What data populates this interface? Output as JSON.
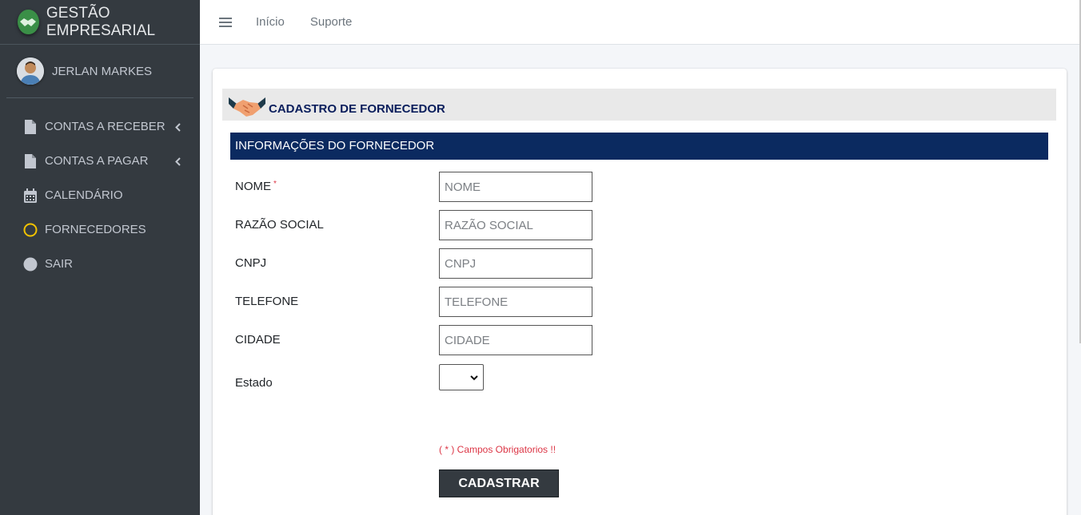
{
  "brand": {
    "title": "GESTÃO EMPRESARIAL"
  },
  "user": {
    "name": "JERLAN MARKES"
  },
  "sidebar": {
    "items": [
      {
        "label": "CONTAS A RECEBER",
        "icon": "file-icon",
        "has_caret": true
      },
      {
        "label": "CONTAS A PAGAR",
        "icon": "file-icon",
        "has_caret": true
      },
      {
        "label": "CALENDÁRIO",
        "icon": "calendar-icon",
        "has_caret": false
      },
      {
        "label": "FORNECEDORES",
        "icon": "circle-outline-icon",
        "has_caret": false
      },
      {
        "label": "SAIR",
        "icon": "circle-filled-icon",
        "has_caret": false
      }
    ]
  },
  "topbar": {
    "links": [
      "Início",
      "Suporte"
    ]
  },
  "page": {
    "title": "CADASTRO DE FORNECEDOR",
    "section": "INFORMAÇÕES DO FORNECEDOR",
    "fields": [
      {
        "label": "NOME",
        "placeholder": "NOME",
        "required": true
      },
      {
        "label": "RAZÃO SOCIAL",
        "placeholder": "RAZÃO SOCIAL",
        "required": false
      },
      {
        "label": "CNPJ",
        "placeholder": "CNPJ",
        "required": false
      },
      {
        "label": "TELEFONE",
        "placeholder": "TELEFONE",
        "required": false
      },
      {
        "label": "CIDADE",
        "placeholder": "CIDADE",
        "required": false
      }
    ],
    "state_label": "Estado",
    "state_value": "",
    "required_marker": "*",
    "required_note": "( * ) Campos Obrigatorios !!",
    "submit_label": "CADASTRAR"
  },
  "colors": {
    "sidebar_bg": "#343a40",
    "section_bar": "#0b2a60",
    "title_text": "#0a1e5c",
    "required": "#dc3545",
    "fornecedores_icon": "#f2c200"
  }
}
